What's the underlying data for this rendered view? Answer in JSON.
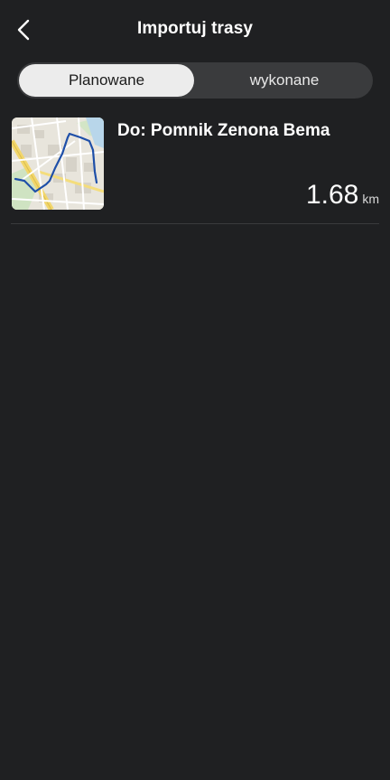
{
  "header": {
    "title": "Importuj trasy",
    "back_icon": "chevron-left-icon"
  },
  "tabs": [
    {
      "label": "Planowane",
      "selected": true
    },
    {
      "label": "wykonane",
      "selected": false
    }
  ],
  "routes": [
    {
      "name": "Do: Pomnik Zenona Bema",
      "distance_value": "1.68",
      "distance_unit": "km",
      "thumbnail_icon": "route-map-thumbnail"
    }
  ],
  "colors": {
    "background": "#1f2022",
    "segment_track": "#3a3b3d",
    "segment_selected": "#ececec",
    "route_line": "#1e4fa8"
  }
}
